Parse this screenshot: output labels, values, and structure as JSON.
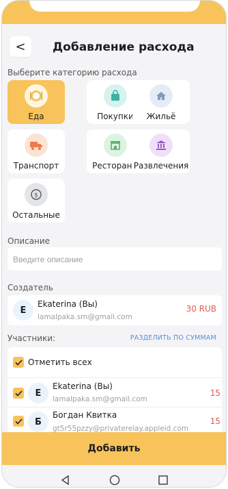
{
  "header": {
    "back_label": "<",
    "title": "Добавление расхода"
  },
  "category_section": {
    "label": "Выберите категорию расхода"
  },
  "categories": [
    {
      "label": "Еда",
      "icon": "food-icon",
      "selected": true
    },
    {
      "label": "Покупки",
      "icon": "shopping-bag-icon",
      "selected": false
    },
    {
      "label": "Жильё",
      "icon": "house-icon",
      "selected": false
    },
    {
      "label": "Транспорт",
      "icon": "truck-icon",
      "selected": false
    },
    {
      "label": "Рестораны",
      "icon": "restaurant-icon",
      "selected": false
    },
    {
      "label": "Развлечения",
      "icon": "landmark-icon",
      "selected": false
    },
    {
      "label": "Остальные",
      "icon": "money-cycle-icon",
      "selected": false
    }
  ],
  "description": {
    "label": "Описание",
    "placeholder": "Введите описание",
    "value": ""
  },
  "creator": {
    "label": "Создатель",
    "initial": "E",
    "name": "Ekaterina (Вы)",
    "email": "lamalpaka.sm@gmail.com",
    "amount": "30 RUB"
  },
  "participants": {
    "label": "Участники:",
    "split_label": "РАЗДЕЛИТЬ ПО СУММАМ",
    "select_all_label": "Отметить всех",
    "list": [
      {
        "initial": "E",
        "name": "Ekaterina (Вы)",
        "email": "lamalpaka.sm@gmail.com",
        "amount": "15"
      },
      {
        "initial": "Б",
        "name": "Богдан Квитка",
        "email": "gt5r55pzzy@privaterelay.appleid.com",
        "amount": "15"
      }
    ]
  },
  "submit": {
    "label": "Добавить"
  },
  "colors": {
    "accent": "#f7c35a",
    "amount_red": "#e05a4e",
    "link_blue": "#5a8fd6"
  }
}
